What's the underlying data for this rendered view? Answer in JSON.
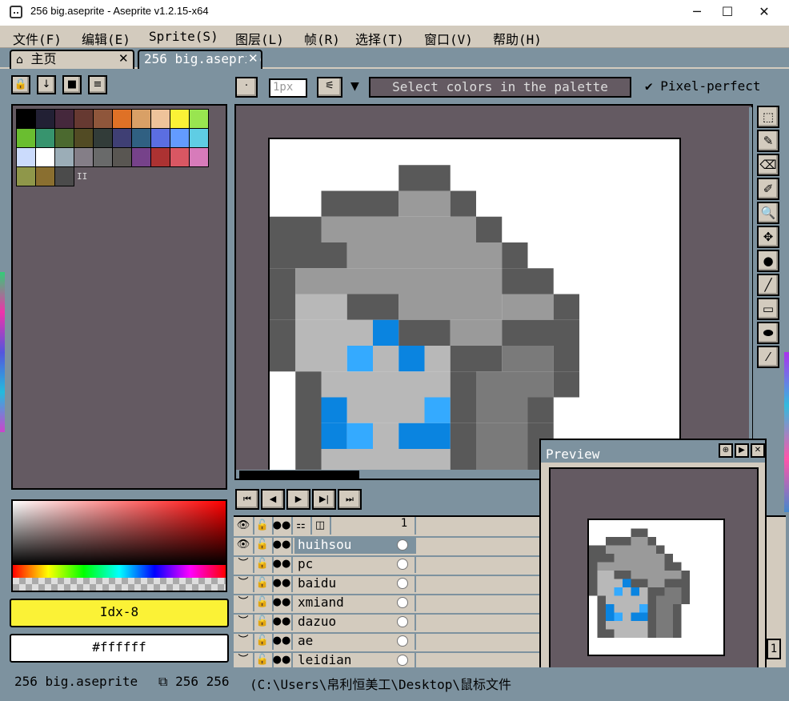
{
  "window": {
    "title": "256 big.aseprite - Aseprite v1.2.15-x64",
    "min": "─",
    "max": "☐",
    "close": "✕"
  },
  "menu": [
    "文件(F)",
    "编辑(E)",
    "Sprite(S)",
    "图层(L)",
    "帧(R)",
    "选择(T)",
    "窗口(V)",
    "帮助(H)"
  ],
  "tabs": {
    "home_label": "主页",
    "home_icon": "home-icon",
    "file_label": "256 big.aseprite",
    "close_glyph": "✕"
  },
  "palette": {
    "buttons": [
      "🔒",
      "↓",
      "■",
      "≡"
    ],
    "count_label": "II",
    "colors": [
      "#000000",
      "#222034",
      "#45283c",
      "#663931",
      "#8f563b",
      "#df7126",
      "#d9a066",
      "#eec39a",
      "#fbf236",
      "#99e550",
      "#6abe30",
      "#37946e",
      "#4b692f",
      "#524b24",
      "#323c39",
      "#3f3f74",
      "#306082",
      "#5b6ee1",
      "#639bff",
      "#5fcde4",
      "#cbdbfc",
      "#ffffff",
      "#9badb7",
      "#847e87",
      "#696a6a",
      "#595652",
      "#76428a",
      "#ac3232",
      "#d95763",
      "#d77bba",
      "#8f974a",
      "#8a6f30",
      "#4b4b4b"
    ]
  },
  "colors": {
    "fg_label": "Idx-8",
    "fg_color": "#fbf236",
    "bg_label": "#ffffff",
    "bg_color": "#ffffff"
  },
  "context_bar": {
    "brush_size": "1px",
    "hint": "Select colors in the palette",
    "pixel_perfect_check": "✔",
    "pixel_perfect": "Pixel-perfect"
  },
  "tools": [
    "⬚",
    "✎",
    "⌫",
    "✐",
    "🔍",
    "✥",
    "●",
    "╱",
    "▭",
    "⬬",
    "⁄"
  ],
  "playback": [
    "⏮",
    "◀",
    "▶",
    "▶|",
    "⏭"
  ],
  "timeline": {
    "header_icons": [
      "👁",
      "🔓",
      "●●",
      "⚏",
      "◫"
    ],
    "frame_number": "1",
    "eye_visible": "👁",
    "eye_hidden": "︶",
    "lock_glyph": "🔓",
    "link_glyph": "●●",
    "layers": [
      {
        "name": "huihsou",
        "visible": true,
        "selected": true
      },
      {
        "name": "pc",
        "visible": false,
        "selected": false
      },
      {
        "name": "baidu",
        "visible": false,
        "selected": false
      },
      {
        "name": "xmiand",
        "visible": false,
        "selected": false
      },
      {
        "name": "dazuo",
        "visible": false,
        "selected": false
      },
      {
        "name": "ae",
        "visible": false,
        "selected": false
      },
      {
        "name": "leidian",
        "visible": false,
        "selected": false
      }
    ]
  },
  "preview": {
    "title": "Preview",
    "buttons": [
      "⊕",
      "▶",
      "✕"
    ]
  },
  "status": {
    "filename": "256 big.aseprite",
    "size": "256 256",
    "path": "(C:\\Users\\帛利恒美工\\Desktop\\鼠标文件"
  },
  "side_num": "1"
}
